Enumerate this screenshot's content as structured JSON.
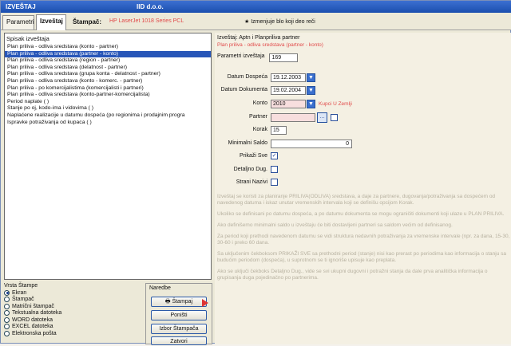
{
  "window": {
    "title": "IZVEŠTAJ",
    "company": "IID d.o.o."
  },
  "tabs": [
    {
      "label": "Parametri"
    },
    {
      "label": "Izveštaj"
    }
  ],
  "toolbar": {
    "stampac_label": "Štampač:",
    "stampac_value": "HP LaserJet 1018 Series PCL",
    "star_label": "Izmenjuje blo koji deo reči"
  },
  "reports": {
    "header": "Spisak izveštaja",
    "items": [
      "Plan priliva - odliva sredstava (konto - partner)",
      "Plan priliva - odliva sredstava (partner - konto)",
      "Plan priliva - odliva sredstava (region - partner)",
      "Plan priliva - odliva sredstava (delatnost - partner)",
      "Plan priliva - odliva sredstava (grupa konta - delatnost - partner)",
      "Plan priliva - odliva sredstava (konto - komerc. - partner)",
      "Plan priliva - po komercijalistima (komercijalisti i partneri)",
      "Plan priliva - odliva sredstava (konto-partner-komercijalista)",
      "Period naplate ( )",
      "Stanje po oj, kodo-ima i vidovima ( )",
      "Naplaćene realizacije u datumu dospeća (po regionima i prodajnim progra",
      "Ispravke potraživanja od kupaca ( )"
    ],
    "selected_index": 1
  },
  "print_type": {
    "header": "Vrsta Štampe",
    "options": [
      "Ekran",
      "Štampač",
      "Matrični štampač",
      "Tekstualna datoteka",
      "WORD datoteka",
      "EXCEL datoteka",
      "Elektronska pošta"
    ],
    "selected_index": 0
  },
  "commands": {
    "header": "Naredbe",
    "print": "Štampaj",
    "cancel": "Poništi",
    "choose_printer": "Izbor Štampača",
    "close": "Zatvori"
  },
  "params": {
    "title": "Izveštaj: Aptn i Planpriliva partner",
    "subtitle": "Plan priliva - odliva sredstava (partner - konto)",
    "param_label": "Parametri izveštaja",
    "param_value": "169",
    "datum_dospeca_label": "Datum Dospeća",
    "datum_dospeca_value": "19.12.2003",
    "datum_dokumenta_label": "Datum Dokumenta",
    "datum_dokumenta_value": "19.02.2004",
    "konto_label": "Konto",
    "konto_value": "2010",
    "konto_extra": "Kupci U Zemlji",
    "partner_label": "Partner",
    "partner_value": "",
    "korak_label": "Korak",
    "korak_value": "15",
    "minimalni_saldo_label": "Minimalni Saldo",
    "minimalni_saldo_value": "0",
    "prikazi_sve_label": "Prikaži Sve",
    "prikazi_sve_checked": true,
    "detaljno_label": "Detaljno Dug.",
    "detaljno_checked": false,
    "strani_label": "Strani Nazivi",
    "strani_checked": false
  },
  "info": {
    "paragraphs": [
      "Izveštaj se koristi za planiranje PRILIVA(ODLIVA) sredstava, a daje za partnere, dugovanja/potraživanja sa dospećem od navedenog datuma i iskaz unutar vremenskih intervala koji se definišu opcijom Korak.",
      "Ukoliko se definisani po datumu dospeća, a po datumu dokumenta se mogu ograničiti dokumenti koji ulaze u PLAN PRILIVA.",
      "Ako definišemo minimalni saldo u izveštaju će biti dostavljeni partneri sa saldom većim od definisanog.",
      "Za period koji prethodi navedenom datumu se vidi struktura nedavnih potraživanja za vremenske intervale (npr. za dana, 15-30, 30-60 i preko 60 dana.",
      "Sa uključenim čekboksom PRIKAŽI SVE sa prethodni period (stanje) nisi kao prerast po periodima kao informacija o stanju sa budućim periodom (dospeća), u suprotnom se ti ignoriše upisuje kao preplata.",
      "Ako se uključi čekboks Detaljno Dug., vide se svi ukupni dugovni i potražni stanja da dale prva analitička informacija o grupisanja duga pojedinačno po partnerima."
    ]
  }
}
